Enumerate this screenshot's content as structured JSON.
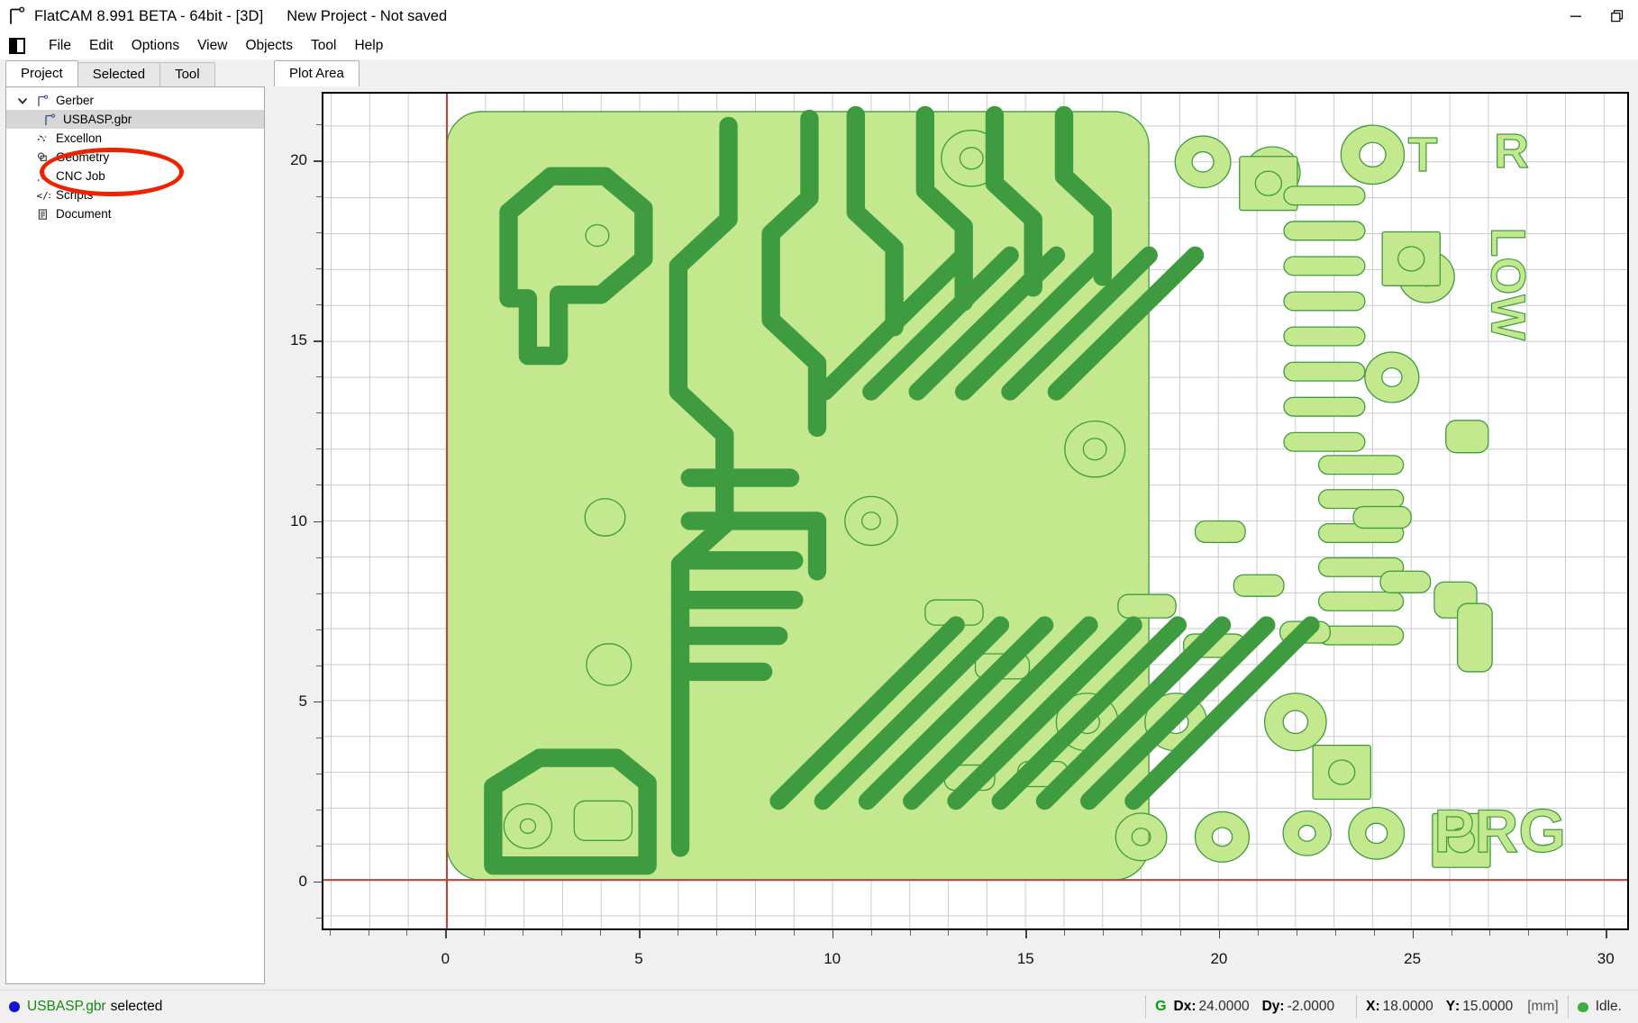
{
  "titlebar": {
    "app_icon": "flatcam-logo-icon",
    "title": "FlatCAM 8.991 BETA - 64bit - [3D]",
    "project": "New Project - Not saved",
    "minimize_label": "minimize-icon",
    "restore_label": "restore-icon"
  },
  "menubar": {
    "toggle_icon": "sidebar-toggle-icon",
    "items": [
      {
        "label": "File"
      },
      {
        "label": "Edit"
      },
      {
        "label": "Options"
      },
      {
        "label": "View"
      },
      {
        "label": "Objects"
      },
      {
        "label": "Tool"
      },
      {
        "label": "Help"
      }
    ]
  },
  "left_panel": {
    "tabs": [
      {
        "label": "Project",
        "active": true
      },
      {
        "label": "Selected",
        "active": false
      },
      {
        "label": "Tool",
        "active": false
      }
    ],
    "tree": [
      {
        "label": "Gerber",
        "icon": "gerber-icon",
        "level": 0,
        "expanded": true,
        "selected": false
      },
      {
        "label": "USBASP.gbr",
        "icon": "gerber-icon",
        "level": 1,
        "expanded": false,
        "selected": true
      },
      {
        "label": "Excellon",
        "icon": "excellon-icon",
        "level": 0,
        "expanded": false,
        "selected": false
      },
      {
        "label": "Geometry",
        "icon": "geometry-icon",
        "level": 0,
        "expanded": false,
        "selected": false
      },
      {
        "label": "CNC Job",
        "icon": "cncjob-icon",
        "level": 0,
        "expanded": false,
        "selected": false
      },
      {
        "label": "Scripts",
        "icon": "scripts-icon",
        "level": 0,
        "expanded": false,
        "selected": false
      },
      {
        "label": "Document",
        "icon": "document-icon",
        "level": 0,
        "expanded": false,
        "selected": false
      }
    ],
    "annotation": {
      "shape": "ellipse",
      "color": "#ee2200"
    }
  },
  "plot_panel": {
    "tabs": [
      {
        "label": "Plot Area",
        "active": true
      }
    ]
  },
  "chart_data": {
    "type": "scatter",
    "title": "Plot Area",
    "xlabel": "",
    "ylabel": "",
    "xlim": [
      -3.2,
      30.6
    ],
    "ylim": [
      -1.35,
      21.9
    ],
    "xticks": [
      0,
      5,
      10,
      15,
      20,
      25,
      30
    ],
    "yticks": [
      0,
      5,
      10,
      15,
      20
    ],
    "minor_tick_step": 1,
    "grid": true,
    "grid_color": "#cccccc",
    "origin_line_color": "#b04a45",
    "gerber_fill": "#c4e88d",
    "gerber_stroke": "#3f9b3f",
    "silkscreen_text": [
      "T",
      "R",
      "LOW",
      "PRG"
    ],
    "object": "USBASP.gbr"
  },
  "statusbar": {
    "selection_file": "USBASP.gbr",
    "selection_suffix": "selected",
    "unit_icon": "G",
    "dx_label": "Dx",
    "dx_value": "24.0000",
    "dy_label": "Dy",
    "dy_value": "-2.0000",
    "x_label": "X",
    "x_value": "18.0000",
    "y_label": "Y",
    "y_value": "15.0000",
    "units": "[mm]",
    "state": "Idle."
  }
}
